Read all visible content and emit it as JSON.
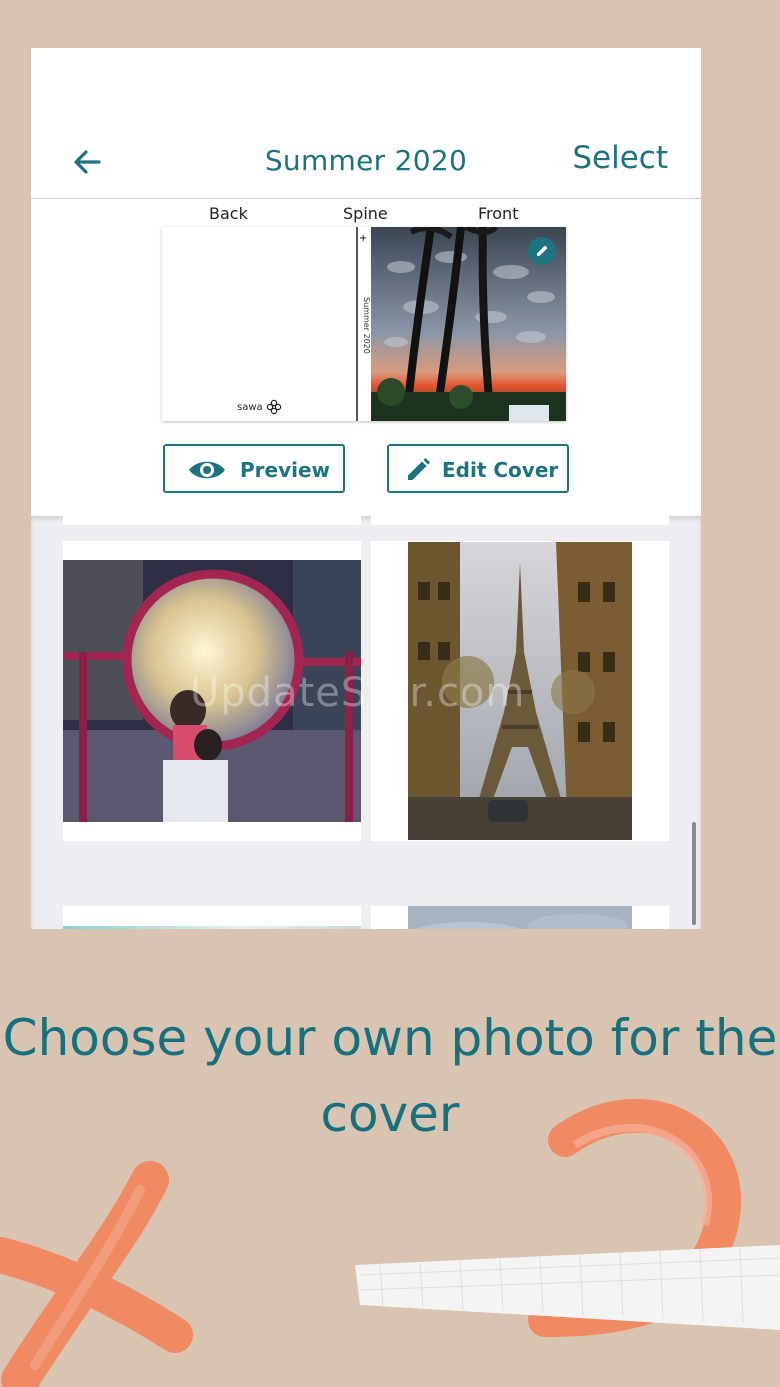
{
  "header": {
    "title": "Summer 2020",
    "select_label": "Select"
  },
  "cover": {
    "labels": {
      "back": "Back",
      "spine": "Spine",
      "front": "Front"
    },
    "spine_title": "Summer 2020",
    "spine_mark": "+",
    "logo_text": "sawa"
  },
  "actions": {
    "preview_label": "Preview",
    "edit_cover_label": "Edit Cover"
  },
  "photos": [
    {
      "name": "mirror-kids-photo"
    },
    {
      "name": "eiffel-tower-photo"
    },
    {
      "name": "sky-tree-photo"
    },
    {
      "name": "cloudy-sky-photo"
    }
  ],
  "watermark": "UpdateStar.com",
  "caption": "Choose your own photo for the cover",
  "colors": {
    "accent": "#1d7380",
    "background": "#d9c3b1",
    "brush": "#ef8a63"
  },
  "icons": [
    "back-arrow-icon",
    "eye-icon",
    "pencil-icon",
    "edit-badge-icon"
  ]
}
